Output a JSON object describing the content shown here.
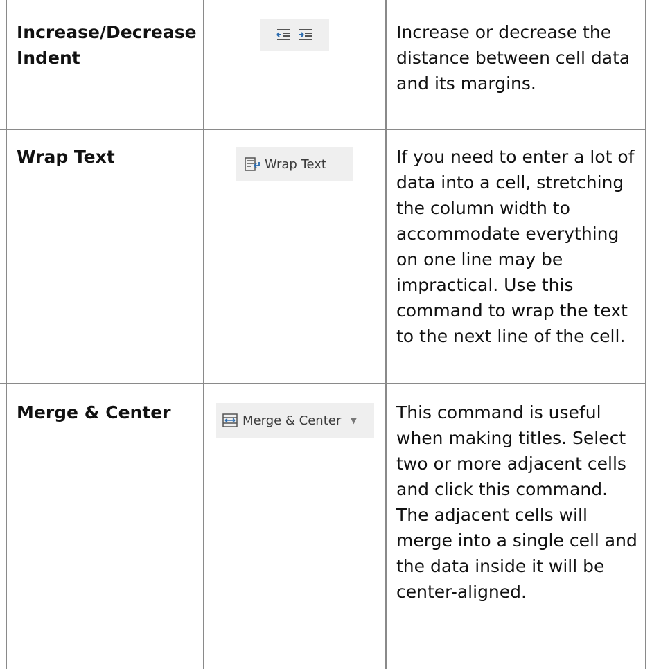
{
  "rows": [
    {
      "label": "Increase/Decrease Indent",
      "label_line1": "Increase/Decrease",
      "label_line2": "Indent",
      "icon": "indent-icons",
      "description": "Increase or decrease the distance between cell data and its margins."
    },
    {
      "label": "Wrap Text",
      "icon": "wrap-text-icon",
      "button_label": "Wrap Text",
      "description": "If you need to enter a lot of data into a cell, stretching the column width to accommodate everything on one line may be impractical. Use this command to wrap the text to the next line of the cell."
    },
    {
      "label": "Merge & Center",
      "icon": "merge-center-icon",
      "button_label": "Merge & Center",
      "dropdown_glyph": "▼",
      "description": "This command is useful when making titles. Select two or more adjacent cells and click this command. The adjacent cells will merge into a single cell and the data inside it will be center-aligned."
    }
  ],
  "colors": {
    "grid": "#8a8a8a",
    "ribbon_bg": "#efefef",
    "icon_blue": "#2b6cb0",
    "icon_gray": "#555555"
  }
}
